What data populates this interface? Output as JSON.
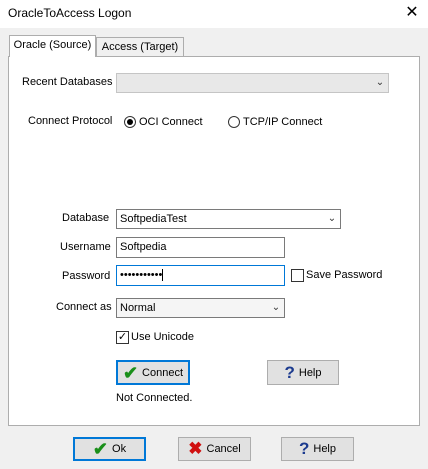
{
  "window": {
    "title": "OracleToAccess Logon",
    "close_icon": "close-icon"
  },
  "tabs": [
    {
      "label": "Oracle (Source)",
      "active": true
    },
    {
      "label": "Access (Target)",
      "active": false
    }
  ],
  "source": {
    "recent_databases_label": "Recent Databases",
    "recent_databases_value": "",
    "connect_protocol_label": "Connect Protocol",
    "protocol_options": [
      "OCI Connect",
      "TCP/IP Connect"
    ],
    "protocol_selected": "OCI Connect",
    "database_label": "Database",
    "database_value": "SoftpediaTest",
    "username_label": "Username",
    "username_value": "Softpedia",
    "password_label": "Password",
    "password_masked": "•••••••••••",
    "save_password_label": "Save Password",
    "save_password_checked": false,
    "connect_as_label": "Connect as",
    "connect_as_value": "Normal",
    "use_unicode_label": "Use Unicode",
    "use_unicode_checked": true,
    "connect_button": "Connect",
    "help_button": "Help",
    "status": "Not Connected."
  },
  "footer": {
    "ok_button": "Ok",
    "cancel_button": "Cancel",
    "help_button": "Help"
  },
  "colors": {
    "focus_border": "#0078d7",
    "check_icon": "#1a8f1a",
    "cancel_icon": "#d01010",
    "help_icon": "#1c3b8f"
  }
}
